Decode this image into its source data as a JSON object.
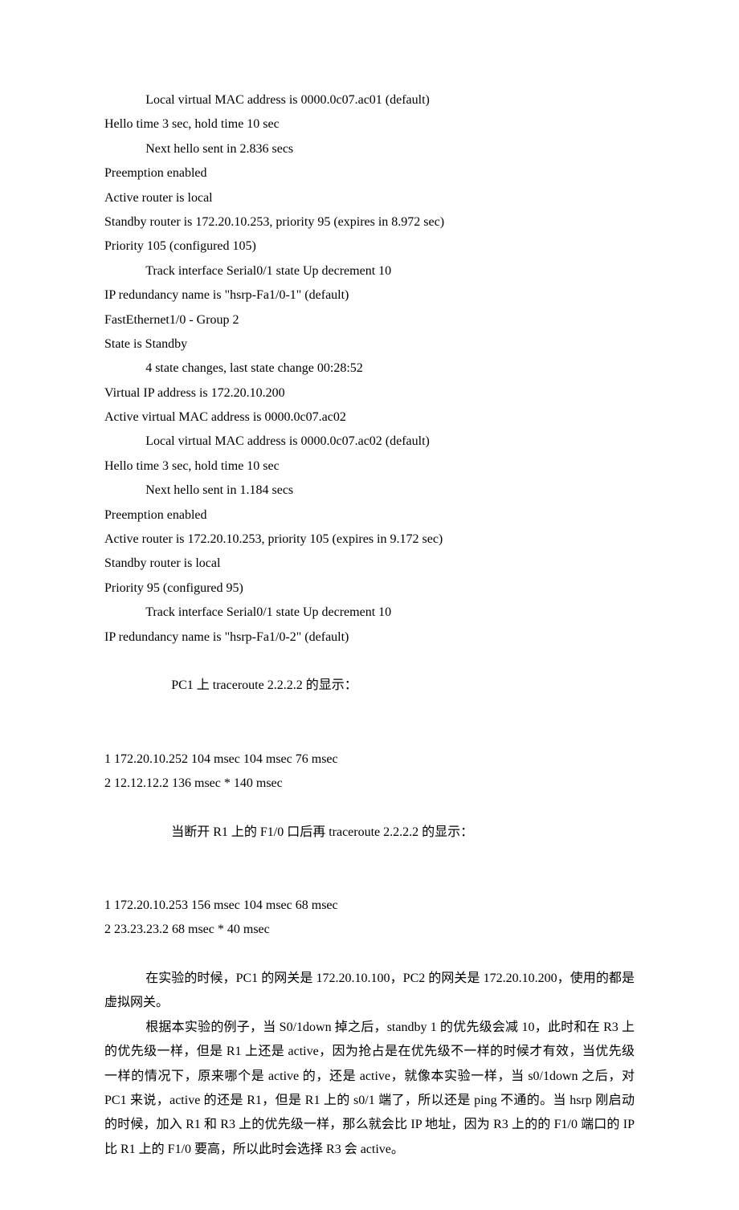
{
  "lines": {
    "l1": "Local virtual MAC address is 0000.0c07.ac01 (default)",
    "l2": "Hello time 3 sec, hold time 10 sec",
    "l3": "Next hello sent in 2.836 secs",
    "l4": "Preemption enabled",
    "l5": "Active router is local",
    "l6": "Standby router is 172.20.10.253, priority 95 (expires in 8.972 sec)",
    "l7": "Priority 105 (configured 105)",
    "l8": "Track interface Serial0/1 state Up decrement 10",
    "l9": "IP redundancy name is \"hsrp-Fa1/0-1\" (default)",
    "l10": "FastEthernet1/0 - Group 2",
    "l11": "State is Standby",
    "l12": "4 state changes, last state change 00:28:52",
    "l13": "Virtual IP address is 172.20.10.200",
    "l14": "Active virtual MAC address is 0000.0c07.ac02",
    "l15": "Local virtual MAC address is 0000.0c07.ac02 (default)",
    "l16": "Hello time 3 sec, hold time 10 sec",
    "l17": "Next hello sent in 1.184 secs",
    "l18": "Preemption enabled",
    "l19": "Active router is 172.20.10.253, priority 105 (expires in 9.172 sec)",
    "l20": "Standby router is local",
    "l21": "Priority 95 (configured 95)",
    "l22": "Track interface Serial0/1 state Up decrement 10",
    "l23": "IP redundancy name is \"hsrp-Fa1/0-2\" (default)",
    "l24": "PC1 上 traceroute 2.2.2.2 的显示：",
    "l25": "1 172.20.10.252 104 msec 104 msec 76 msec",
    "l26": "2 12.12.12.2 136 msec * 140 msec",
    "l27": "当断开 R1 上的 F1/0 口后再 traceroute 2.2.2.2 的显示：",
    "l28": "1 172.20.10.253 156 msec 104 msec 68 msec",
    "l29": "2 23.23.23.2 68 msec * 40 msec",
    "p1": "在实验的时候，PC1 的网关是 172.20.10.100，PC2 的网关是 172.20.10.200，使用的都是虚拟网关。",
    "p2": "根据本实验的例子，当 S0/1down 掉之后，standby 1 的优先级会减 10，此时和在 R3 上的优先级一样，但是 R1 上还是 active，因为抢占是在优先级不一样的时候才有效，当优先级一样的情况下，原来哪个是 active 的，还是 active，就像本实验一样，当 s0/1down 之后，对 PC1 来说，active 的还是 R1，但是 R1 上的 s0/1 端了，所以还是 ping 不通的。当 hsrp 刚启动的时候，加入 R1 和 R3 上的优先级一样，那么就会比 IP 地址，因为 R3 上的的 F1/0 端口的 IP 比 R1 上的 F1/0 要高，所以此时会选择 R3 会 active。"
  }
}
